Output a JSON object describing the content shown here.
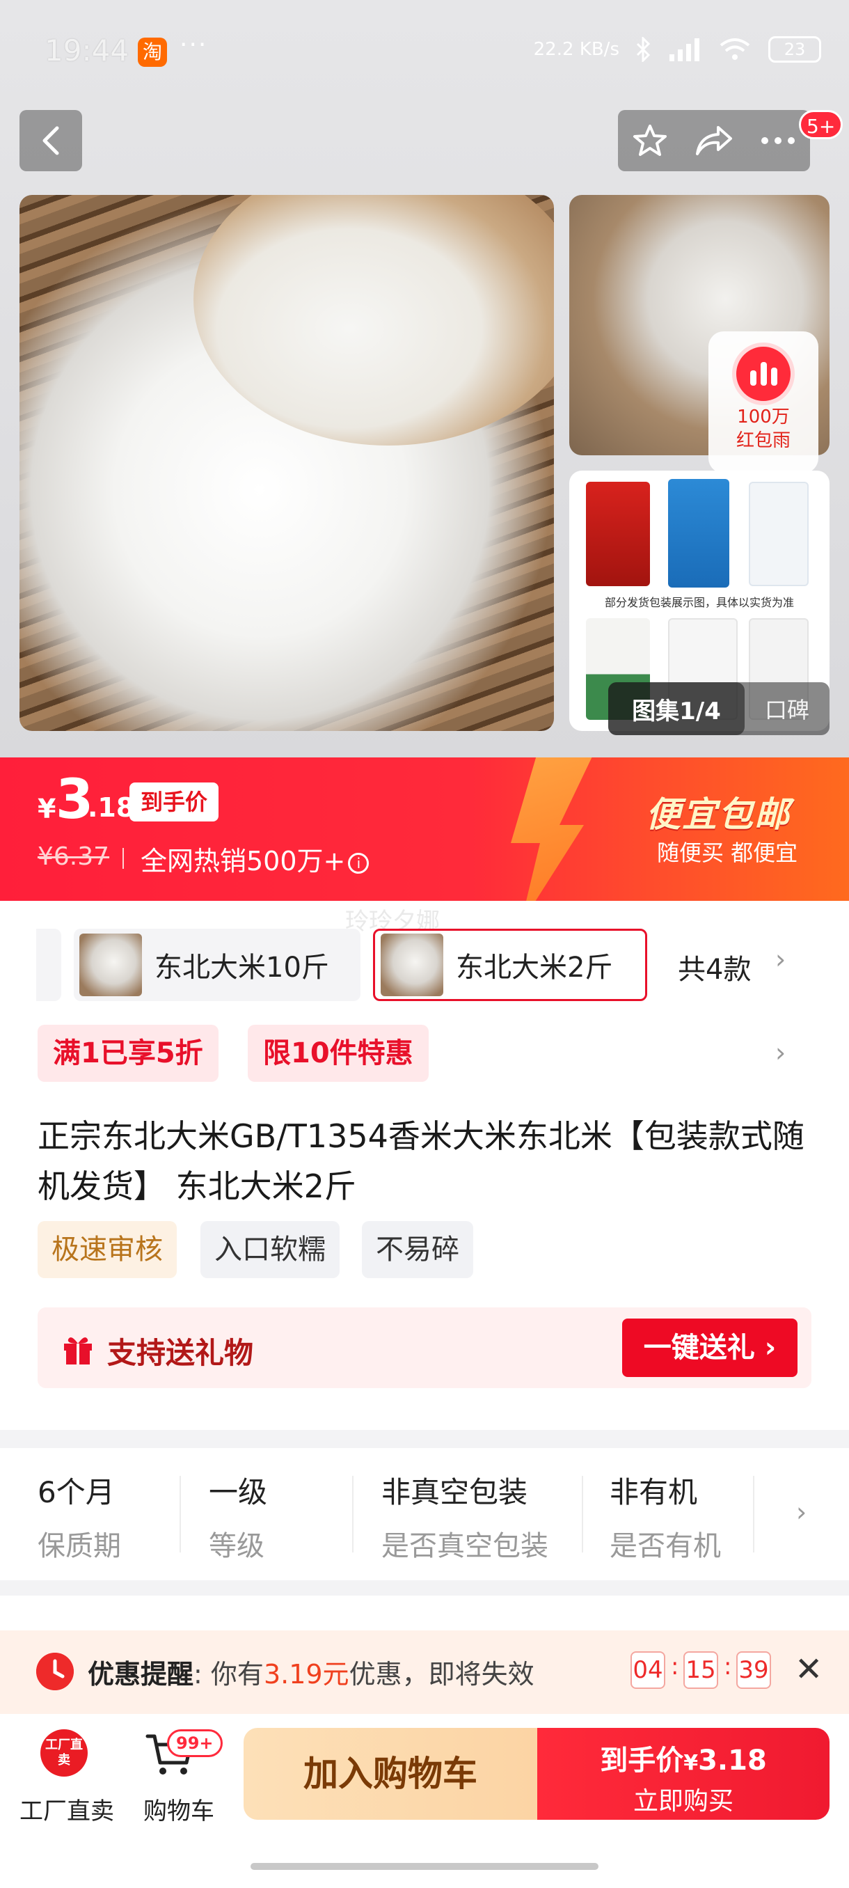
{
  "status_bar": {
    "time": "19:44",
    "app_badge": "淘",
    "more": "···",
    "net_speed": "22.2 KB/s",
    "battery": "23"
  },
  "header": {
    "notify_badge": "5+"
  },
  "gallery": {
    "hongbao_line1": "100万",
    "hongbao_line2": "红包雨",
    "pill_active": "图集1/4",
    "pill_other": "口碑",
    "package_note": "部分发货包装展示图，具体以实货为准"
  },
  "price": {
    "currency": "¥",
    "integer": "3",
    "decimal": ".18",
    "tag": "到手价",
    "original": "¥6.37",
    "hot_sale": "全网热销500万+",
    "promo_title": "便宜包邮",
    "promo_sub": "随便买 都便宜",
    "accent_color": "#ff1f3a"
  },
  "watermark": "玲玲夕娜",
  "variants": {
    "items": [
      "东北大米10斤",
      "东北大米2斤"
    ],
    "selected_index": 1,
    "count_label": "共4款"
  },
  "promos": [
    "满1已享5折",
    "限10件特惠"
  ],
  "product": {
    "title": "正宗东北大米GB/T1354香米大米东北米【包装款式随机发货】 东北大米2斤",
    "features": [
      "极速审核",
      "入口软糯",
      "不易碎"
    ]
  },
  "gift": {
    "label": "支持送礼物",
    "button": "一键送礼 ›"
  },
  "specs": [
    {
      "value": "6个月",
      "key": "保质期"
    },
    {
      "value": "一级",
      "key": "等级"
    },
    {
      "value": "非真空包装",
      "key": "是否真空包装"
    },
    {
      "value": "非有机",
      "key": "是否有机"
    }
  ],
  "reminder": {
    "title": "优惠提醒",
    "colon": ":",
    "text_pre": "你有",
    "amount": "3.19元",
    "text_post": "优惠，即将失效",
    "countdown": [
      "04",
      "15",
      "39"
    ]
  },
  "bottom_bar": {
    "factory_icon_text": "工厂直卖",
    "factory_label": "工厂直卖",
    "cart_badge": "99+",
    "cart_label": "购物车",
    "add_to_cart": "加入购物车",
    "buy_line1_prefix": "到手价",
    "buy_line1_currency": "¥",
    "buy_line1_price": "3.18",
    "buy_line2": "立即购买"
  }
}
